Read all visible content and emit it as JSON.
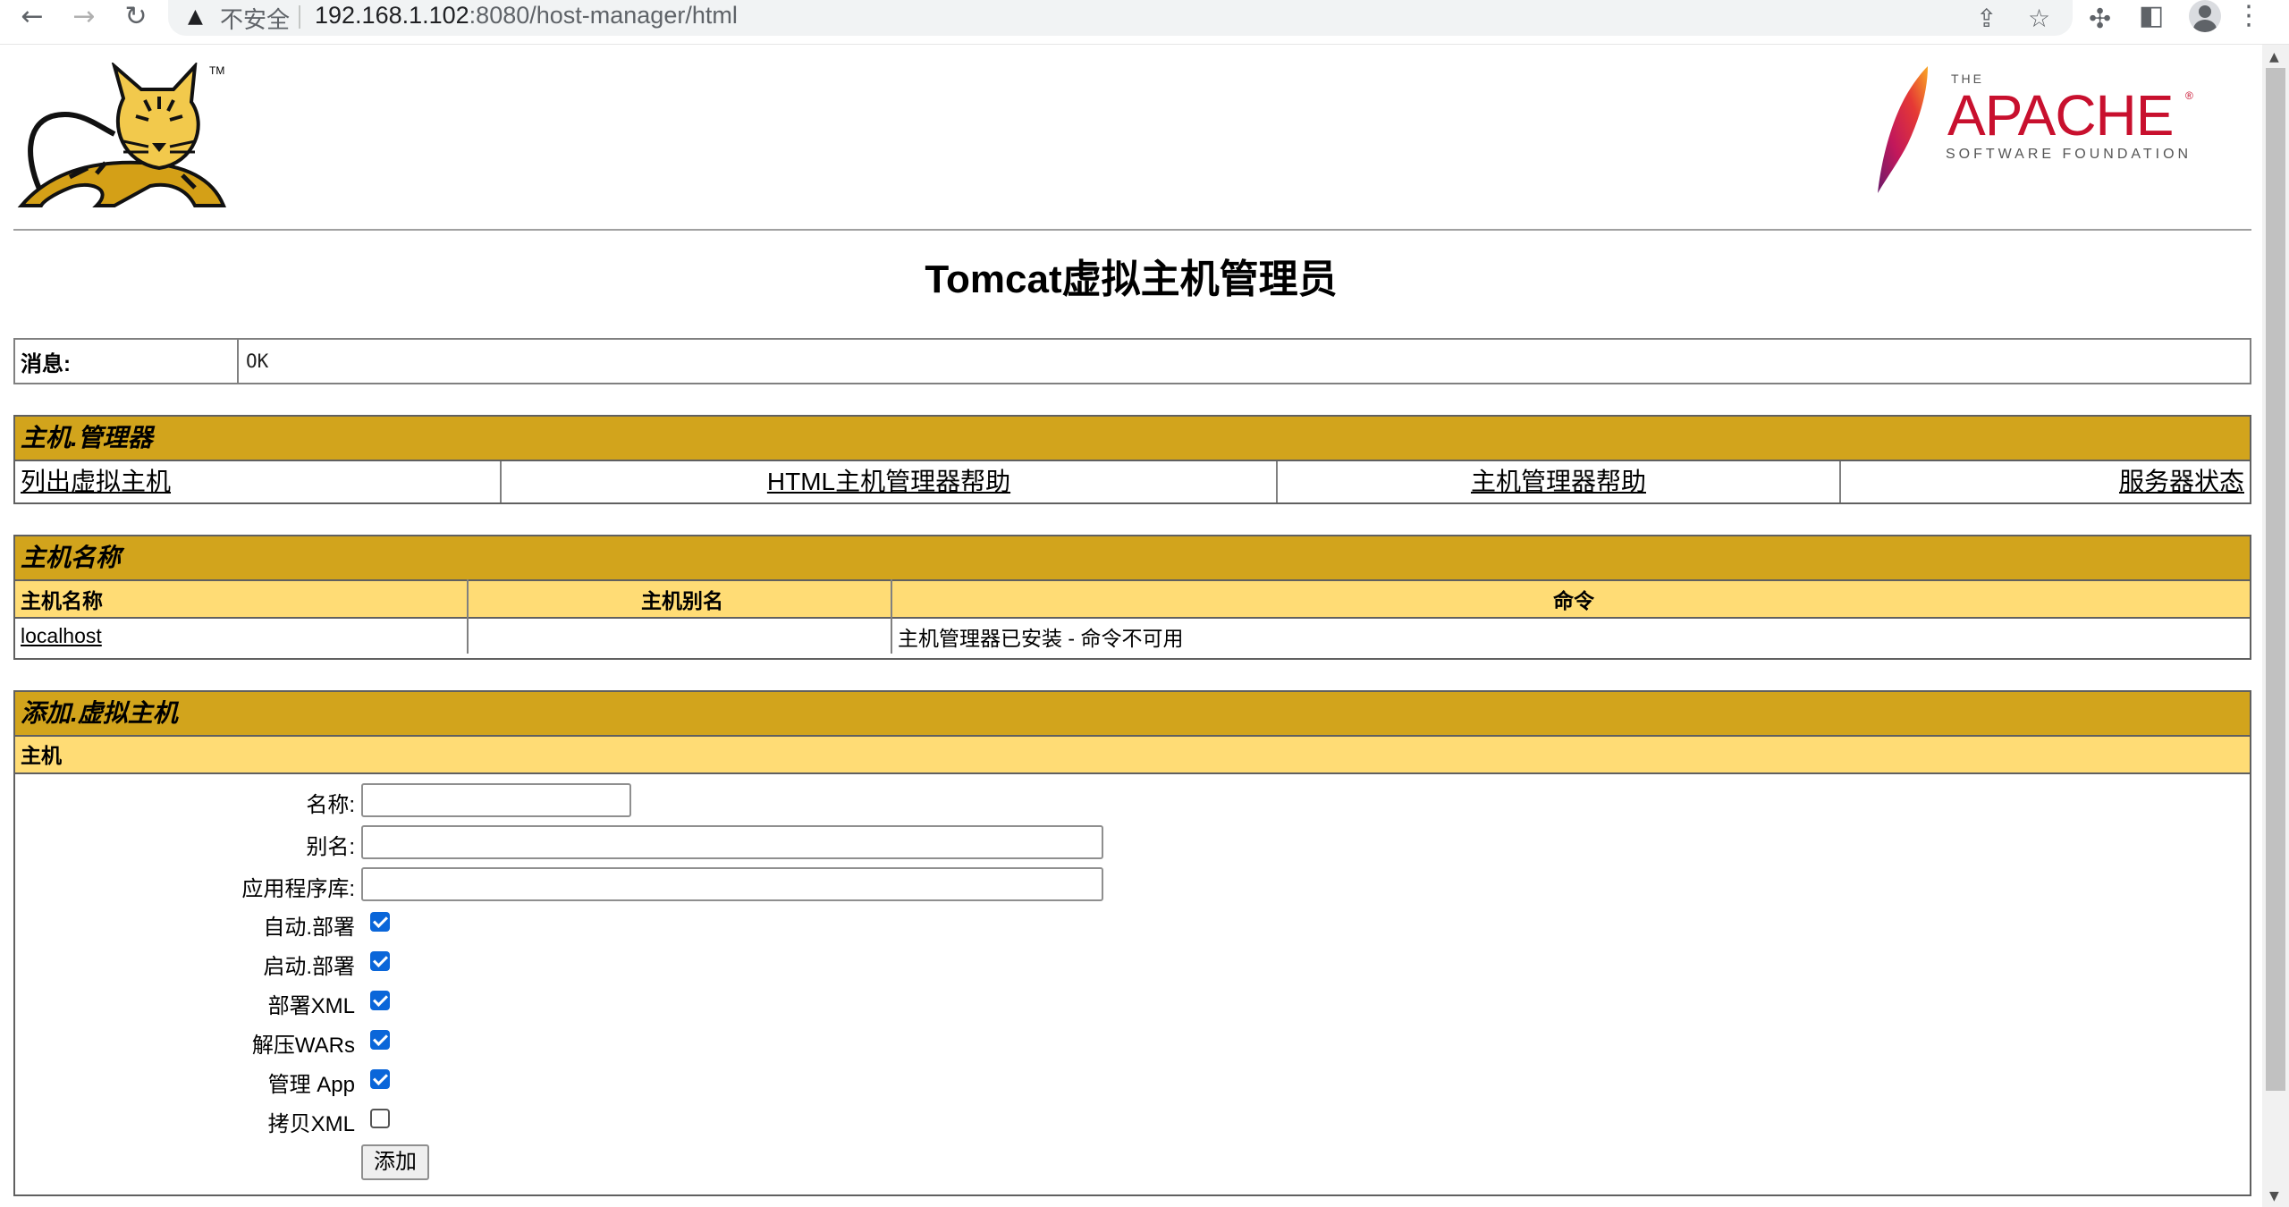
{
  "browser": {
    "insecure_label": "不安全",
    "url_host": "192.168.1.102",
    "url_rest": ":8080/host-manager/html"
  },
  "header": {
    "tomcat_tm": "TM",
    "apache_the": "THE",
    "apache_name": "APACHE",
    "apache_reg": "®",
    "apache_sub": "SOFTWARE FOUNDATION"
  },
  "page_title": "Tomcat虚拟主机管理员",
  "message": {
    "label": "消息:",
    "value": "OK"
  },
  "manager_section": {
    "heading": "主机.管理器",
    "links": [
      "列出虚拟主机",
      "HTML主机管理器帮助",
      "主机管理器帮助",
      "服务器状态"
    ]
  },
  "hosts_section": {
    "heading": "主机名称",
    "columns": [
      "主机名称",
      "主机别名",
      "命令"
    ],
    "rows": [
      {
        "name": "localhost",
        "aliases": "",
        "command": "主机管理器已安装 - 命令不可用"
      }
    ]
  },
  "add_section": {
    "heading": "添加.虚拟主机",
    "subheading": "主机",
    "fields": {
      "name_label": "名称:",
      "name_value": "",
      "aliases_label": "别名:",
      "aliases_value": "",
      "appbase_label": "应用程序库:",
      "appbase_value": ""
    },
    "checkboxes": [
      {
        "label": "自动.部署",
        "checked": true
      },
      {
        "label": "启动.部署",
        "checked": true
      },
      {
        "label": "部署XML",
        "checked": true
      },
      {
        "label": "解压WARs",
        "checked": true
      },
      {
        "label": "管理 App",
        "checked": true
      },
      {
        "label": "拷贝XML",
        "checked": false
      }
    ],
    "submit_label": "添加"
  },
  "colors": {
    "section_header": "#d2a41c",
    "column_header": "#ffdc75",
    "checkbox_on": "#0a66d9"
  }
}
